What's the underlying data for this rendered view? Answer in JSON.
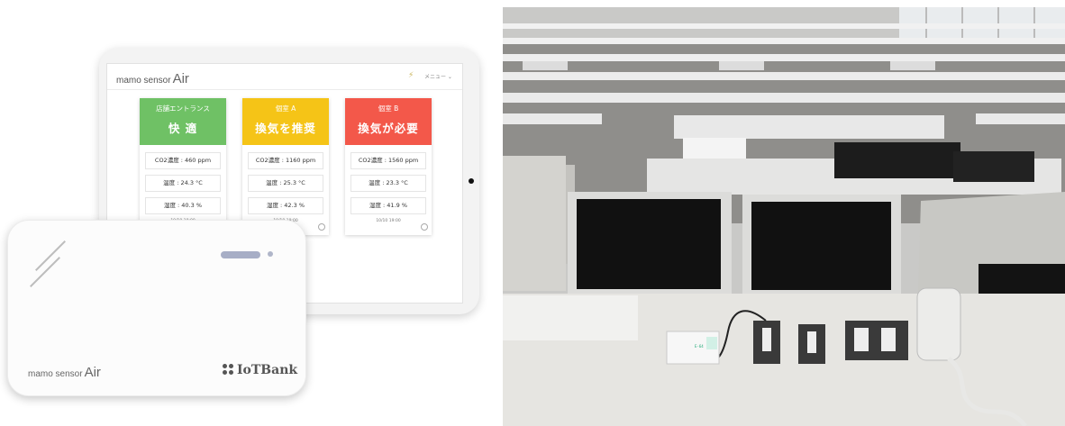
{
  "app": {
    "logo_prefix": "mamo sensor",
    "logo_air": "Air",
    "menu_label": "メニュー ⌄"
  },
  "rooms": [
    {
      "name": "店舗エントランス",
      "status": "快 適",
      "color": "#6fc165",
      "co2": "CO2濃度 : 460 ppm",
      "temp": "温度 : 24.3 °C",
      "humidity": "湿度 : 40.3 %",
      "time": "10/10 19:00"
    },
    {
      "name": "個室 A",
      "status": "換気を推奨",
      "color": "#f5c417",
      "co2": "CO2濃度 : 1160 ppm",
      "temp": "温度 : 25.3 °C",
      "humidity": "湿度 : 42.3 %",
      "time": "10/10 19:00"
    },
    {
      "name": "個室 B",
      "status": "換気が必要",
      "color": "#f3584a",
      "co2": "CO2濃度 : 1560 ppm",
      "temp": "温度 : 23.3 °C",
      "humidity": "湿度 : 41.9 %",
      "time": "10/10 19:00"
    }
  ],
  "device": {
    "logo_prefix": "mamo sensor",
    "logo_air": "Air",
    "brand": "IoTBank"
  },
  "photo": {
    "device_label": "E-64"
  }
}
